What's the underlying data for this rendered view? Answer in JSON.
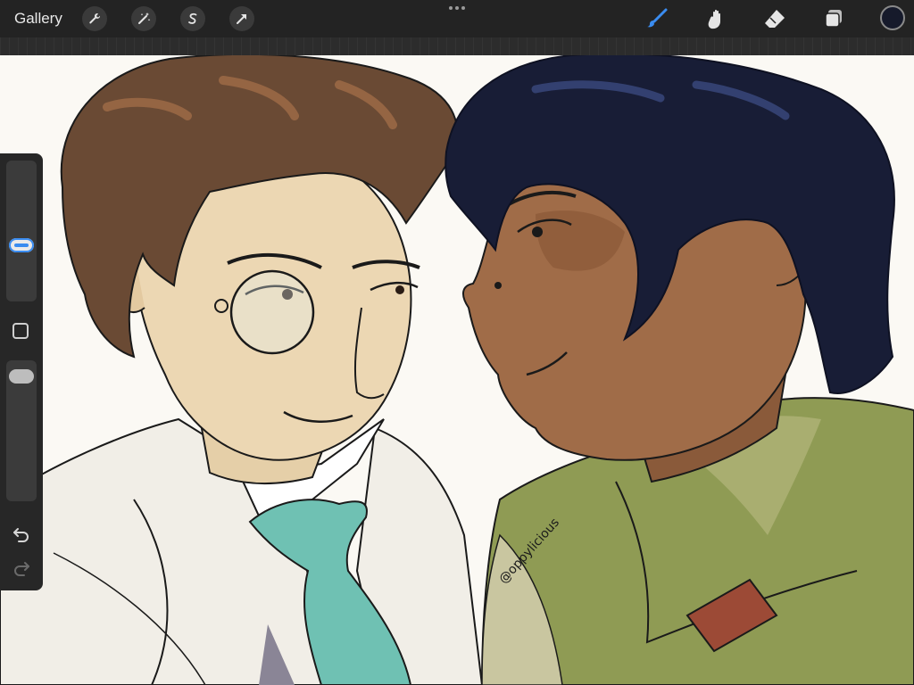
{
  "toolbar": {
    "gallery_label": "Gallery",
    "left_tools": [
      "wrench-icon",
      "magic-wand-icon",
      "selection-icon",
      "transform-arrow-icon"
    ],
    "right_tools": [
      "brush-icon",
      "smudge-icon",
      "eraser-icon",
      "layers-icon"
    ],
    "active_tool": "brush-icon",
    "active_color": "#161a2b",
    "accent": "#3a8cf0"
  },
  "sidebar": {
    "brush_size_level": 0.38,
    "opacity_level": 0.05,
    "icons": [
      "modify-square-icon",
      "undo-icon",
      "redo-icon"
    ]
  },
  "canvas": {
    "signature": "@oppylicious"
  }
}
